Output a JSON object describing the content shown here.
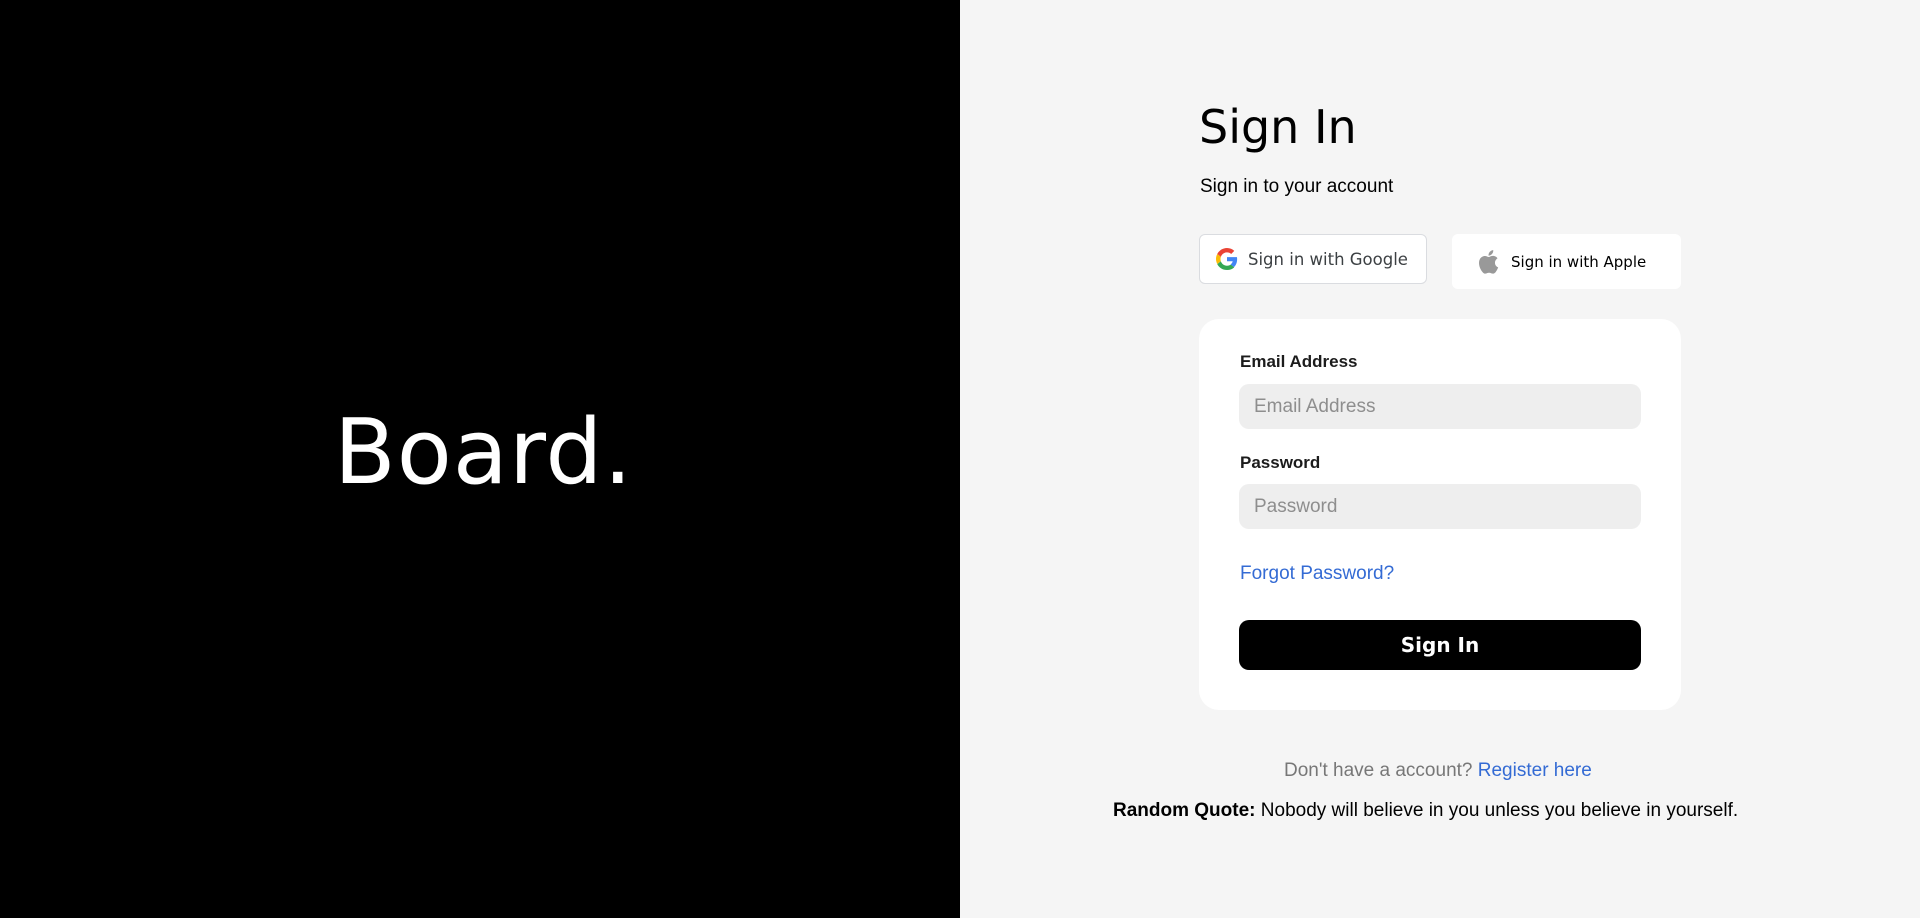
{
  "brand": {
    "logo_text": "Board."
  },
  "signin": {
    "title": "Sign In",
    "subtitle": "Sign in to your account",
    "google_label": "Sign in with Google",
    "apple_label": "Sign in with Apple"
  },
  "form": {
    "email_label": "Email Address",
    "email_placeholder": "Email Address",
    "email_value": "",
    "password_label": "Password",
    "password_placeholder": "Password",
    "password_value": "",
    "forgot_label": "Forgot Password?",
    "submit_label": "Sign In"
  },
  "footer": {
    "register_prompt": "Don't have a account?",
    "register_link": "Register here",
    "quote_label": "Random Quote:",
    "quote_text": "Nobody will believe in you unless you believe in yourself."
  },
  "icons": {
    "google": "google-icon",
    "apple": "apple-icon"
  },
  "colors": {
    "left_panel": "#000000",
    "right_panel": "#f5f5f5",
    "link": "#346bd4",
    "button": "#000000"
  }
}
